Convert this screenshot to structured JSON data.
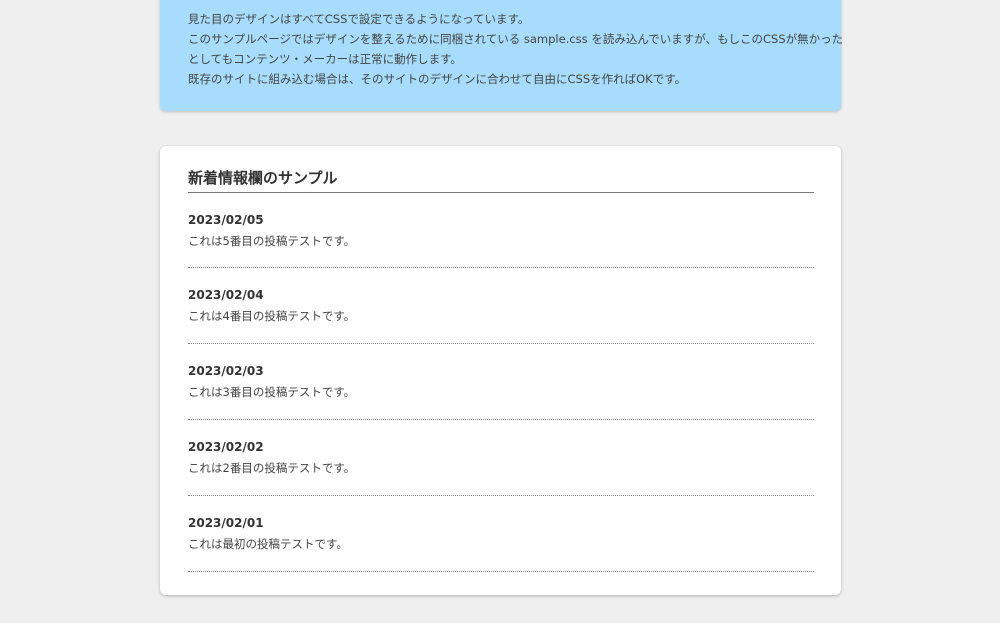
{
  "info": {
    "lines": [
      "見た目のデザインはすべてCSSで設定できるようになっています。",
      "このサンプルページではデザインを整えるために同梱されている sample.css を読み込んでいますが、もしこのCSSが無かった",
      "としてもコンテンツ・メーカーは正常に動作します。",
      "既存のサイトに組み込む場合は、そのサイトのデザインに合わせて自由にCSSを作ればOKです。"
    ]
  },
  "news": {
    "title": "新着情報欄のサンプル",
    "items": [
      {
        "date": "2023/02/05",
        "text": "これは5番目の投稿テストです。"
      },
      {
        "date": "2023/02/04",
        "text": "これは4番目の投稿テストです。"
      },
      {
        "date": "2023/02/03",
        "text": "これは3番目の投稿テストです。"
      },
      {
        "date": "2023/02/02",
        "text": "これは2番目の投稿テストです。"
      },
      {
        "date": "2023/02/01",
        "text": "これは最初の投稿テストです。"
      }
    ]
  },
  "colors": {
    "page_background": "#efefef",
    "info_background": "#a8dcfc",
    "card_background": "#ffffff",
    "text": "#444444"
  }
}
